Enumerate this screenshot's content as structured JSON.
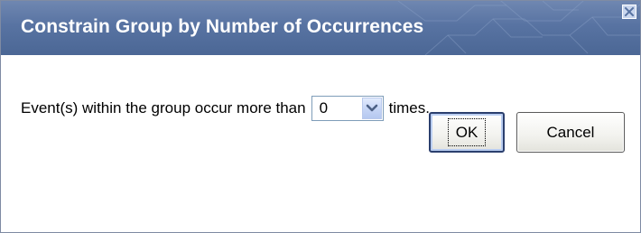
{
  "dialog": {
    "title": "Constrain Group by Number of Occurrences",
    "close_icon": "close-icon",
    "prompt_before": "Event(s) within the group occur more than",
    "prompt_after": "times.",
    "count_select": {
      "selected_value": "0",
      "arrow_icon": "chevron-down-icon"
    },
    "buttons": {
      "ok_label": "OK",
      "cancel_label": "Cancel"
    }
  },
  "colors": {
    "titlebar": "#5873a2",
    "title_text": "#ffffff",
    "select_border": "#7f9db9",
    "arrow": "#4d6185",
    "ok_border": "#2b3f6e"
  }
}
